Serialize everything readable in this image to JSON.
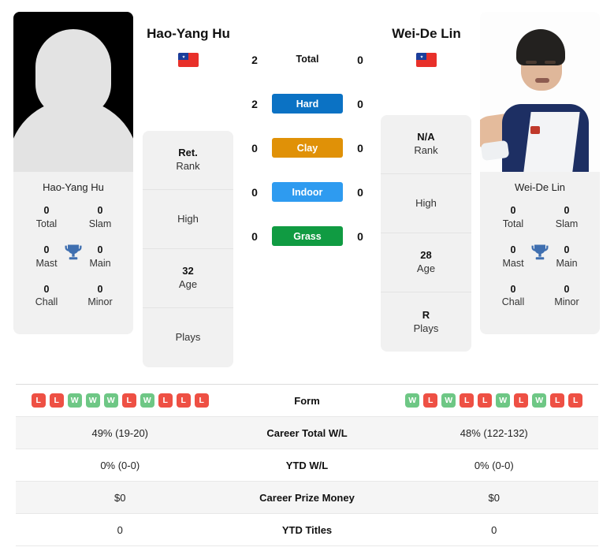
{
  "players": {
    "left": {
      "name": "Hao-Yang Hu",
      "flag": "taiwan-flag",
      "photo_type": "silhouette-placeholder",
      "card_name": "Hao-Yang Hu",
      "titles": [
        {
          "value": "0",
          "label": "Total"
        },
        {
          "value": "0",
          "label": "Slam"
        },
        {
          "value": "0",
          "label": "Mast"
        },
        {
          "value": "0",
          "label": "Main"
        },
        {
          "value": "0",
          "label": "Chall"
        },
        {
          "value": "0",
          "label": "Minor"
        }
      ],
      "info": [
        {
          "value": "Ret.",
          "label": "Rank"
        },
        {
          "value": "",
          "label": "High"
        },
        {
          "value": "32",
          "label": "Age"
        },
        {
          "value": "",
          "label": "Plays"
        }
      ]
    },
    "right": {
      "name": "Wei-De Lin",
      "flag": "taiwan-flag",
      "photo_type": "player-portrait",
      "card_name": "Wei-De Lin",
      "titles": [
        {
          "value": "0",
          "label": "Total"
        },
        {
          "value": "0",
          "label": "Slam"
        },
        {
          "value": "0",
          "label": "Mast"
        },
        {
          "value": "0",
          "label": "Main"
        },
        {
          "value": "0",
          "label": "Chall"
        },
        {
          "value": "0",
          "label": "Minor"
        }
      ],
      "info": [
        {
          "value": "N/A",
          "label": "Rank"
        },
        {
          "value": "",
          "label": "High"
        },
        {
          "value": "28",
          "label": "Age"
        },
        {
          "value": "R",
          "label": "Plays"
        }
      ]
    }
  },
  "head_to_head": [
    {
      "label": "Total",
      "left": "2",
      "right": "0",
      "styled": false,
      "color": ""
    },
    {
      "label": "Hard",
      "left": "2",
      "right": "0",
      "styled": true,
      "color": "#0b72c4"
    },
    {
      "label": "Clay",
      "left": "0",
      "right": "0",
      "styled": true,
      "color": "#e09107"
    },
    {
      "label": "Indoor",
      "left": "0",
      "right": "0",
      "styled": true,
      "color": "#2e9bf0"
    },
    {
      "label": "Grass",
      "left": "0",
      "right": "0",
      "styled": true,
      "color": "#109b42"
    }
  ],
  "comparison_table": {
    "form_row": {
      "label": "Form",
      "left": [
        "L",
        "L",
        "W",
        "W",
        "W",
        "L",
        "W",
        "L",
        "L",
        "L"
      ],
      "right": [
        "W",
        "L",
        "W",
        "L",
        "L",
        "W",
        "L",
        "W",
        "L",
        "L"
      ]
    },
    "rows": [
      {
        "label": "Career Total W/L",
        "left": "49% (19-20)",
        "right": "48% (122-132)"
      },
      {
        "label": "YTD W/L",
        "left": "0% (0-0)",
        "right": "0% (0-0)"
      },
      {
        "label": "Career Prize Money",
        "left": "$0",
        "right": "$0"
      },
      {
        "label": "YTD Titles",
        "left": "0",
        "right": "0"
      }
    ]
  },
  "icons": {
    "trophy": "trophy-icon"
  },
  "colors": {
    "win": "#6ec785",
    "loss": "#ee5044",
    "hard": "#0b72c4",
    "clay": "#e09107",
    "indoor": "#2e9bf0",
    "grass": "#109b42",
    "trophy": "#3f6fb0"
  }
}
